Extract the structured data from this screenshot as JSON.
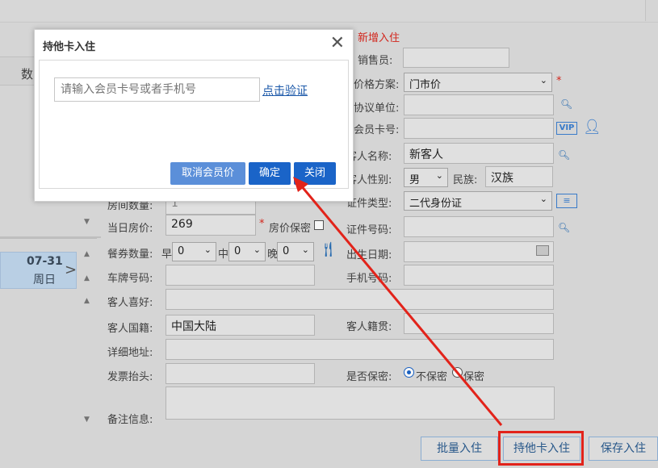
{
  "modal": {
    "title": "持他卡入住",
    "search_placeholder": "请输入会员卡号或者手机号",
    "verify_link": "点击验证",
    "btn_cancel_member_price": "取消会员价",
    "btn_confirm": "确定",
    "btn_close": "关闭"
  },
  "page": {
    "new_checkin": "新增入住",
    "sidebar_col_label": "数",
    "date_label": "07-31",
    "weekday_label": "周日",
    "labels": {
      "salesperson": "销售员:",
      "price_plan": "价格方案:",
      "agreement_unit": "协议单位:",
      "member_card": "会员卡号:",
      "guest_name": "客人名称:",
      "guest_gender": "客人性别:",
      "ethnicity": "民族:",
      "id_type": "证件类型:",
      "id_number": "证件号码:",
      "birth_date": "出生日期:",
      "phone": "手机号码:",
      "room_count": "房间数量:",
      "daily_rate": "当日房价:",
      "rate_secret": "房价保密",
      "meal_count": "餐券数量:",
      "breakfast": "早",
      "lunch": "中",
      "dinner": "晚",
      "plate_no": "车牌号码:",
      "preference": "客人喜好:",
      "nationality": "客人国籍:",
      "native_place": "客人籍贯:",
      "address": "详细地址:",
      "invoice_title": "发票抬头:",
      "is_secret": "是否保密:",
      "not_secret": "不保密",
      "secret": "保密",
      "remarks": "备注信息:"
    },
    "values": {
      "price_plan": "门市价",
      "guest_name": "新客人",
      "gender": "男",
      "ethnicity": "汉族",
      "id_type": "二代身份证",
      "room_count": "1",
      "daily_rate": "269",
      "breakfast": "0",
      "lunch": "0",
      "dinner": "0",
      "nationality": "中国大陆"
    },
    "vip_badge": "VIP",
    "required_mark": "*"
  },
  "bottom_buttons": {
    "batch_checkin": "批量入住",
    "other_card_checkin": "持他卡入住",
    "save_checkin": "保存入住"
  },
  "colors": {
    "primary_btn": "#1a64c8",
    "secondary_btn": "#5b8fd9",
    "link": "#1a57a8",
    "annotation_red": "#e2231a"
  }
}
